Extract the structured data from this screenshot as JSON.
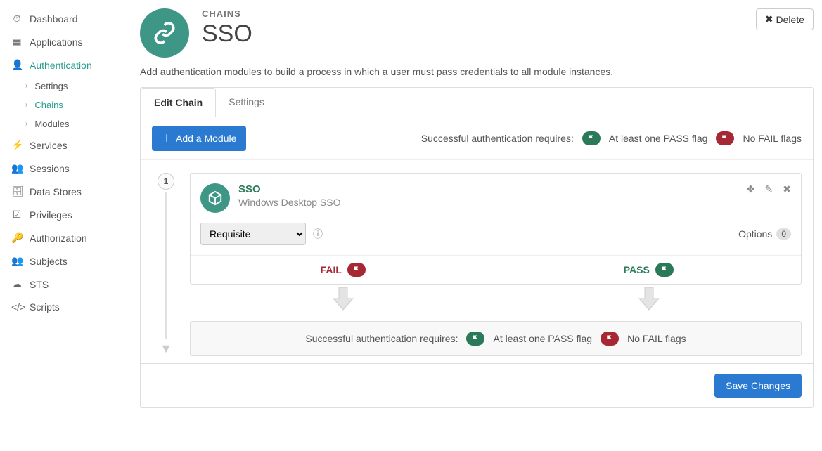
{
  "sidebar": {
    "items": [
      {
        "icon": "dashboard",
        "label": "Dashboard"
      },
      {
        "icon": "apps",
        "label": "Applications"
      },
      {
        "icon": "user",
        "label": "Authentication",
        "active": true
      },
      {
        "icon": "bolt",
        "label": "Services"
      },
      {
        "icon": "users",
        "label": "Sessions"
      },
      {
        "icon": "db",
        "label": "Data Stores"
      },
      {
        "icon": "check",
        "label": "Privileges"
      },
      {
        "icon": "key",
        "label": "Authorization"
      },
      {
        "icon": "group",
        "label": "Subjects"
      },
      {
        "icon": "sts",
        "label": "STS"
      },
      {
        "icon": "code",
        "label": "Scripts"
      }
    ],
    "sub": [
      {
        "label": "Settings"
      },
      {
        "label": "Chains",
        "active": true
      },
      {
        "label": "Modules"
      }
    ]
  },
  "header": {
    "eyebrow": "CHAINS",
    "title": "SSO",
    "delete": "Delete"
  },
  "description": "Add authentication modules to build a process in which a user must pass credentials to all module instances.",
  "tabs": [
    {
      "label": "Edit Chain",
      "active": true
    },
    {
      "label": "Settings"
    }
  ],
  "toolbar": {
    "add": "Add a Module",
    "req_label": "Successful authentication requires:",
    "pass_text": "At least one PASS flag",
    "fail_text": "No FAIL flags"
  },
  "module": {
    "step": "1",
    "title": "SSO",
    "subtitle": "Windows Desktop SSO",
    "criteria": "Requisite",
    "options_label": "Options",
    "options_count": "0",
    "fail": "FAIL",
    "pass": "PASS"
  },
  "summary": {
    "label": "Successful authentication requires:",
    "pass_text": "At least one PASS flag",
    "fail_text": "No FAIL flags"
  },
  "footer": {
    "save": "Save Changes"
  }
}
